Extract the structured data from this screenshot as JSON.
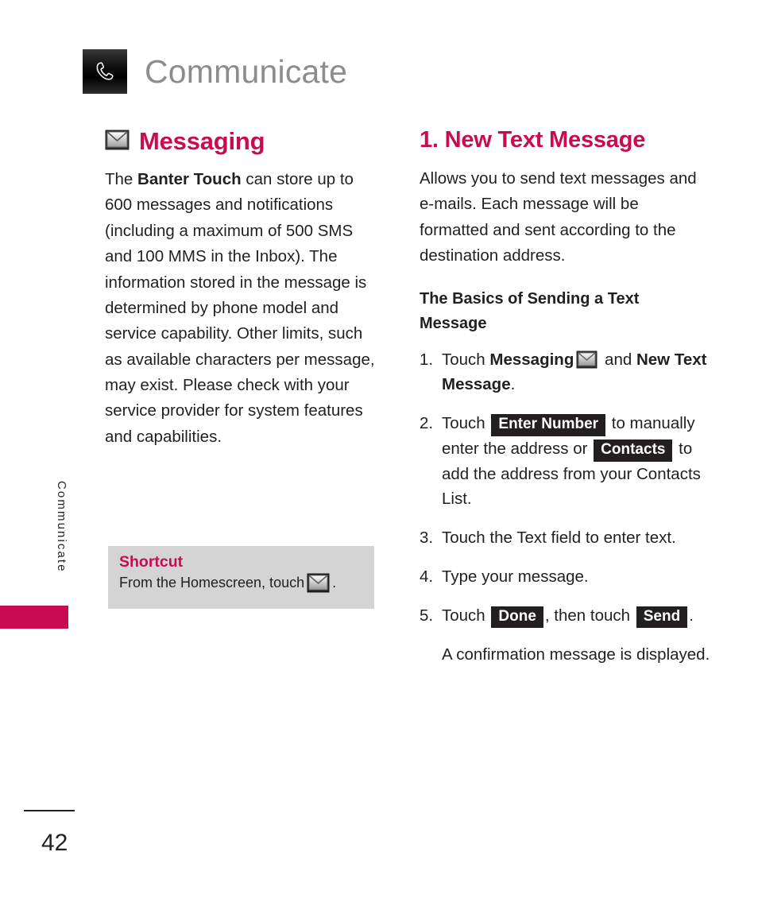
{
  "page": {
    "header_title": "Communicate",
    "header_icon": "phone-handset-icon",
    "side_tab_label": "Communicate",
    "page_number": "42",
    "accent_color": "#C80C52",
    "header_title_color": "#8C8C8C",
    "callout_bg_color": "#D4D4D4",
    "key_chip_color": "#231F20"
  },
  "left_column": {
    "heading": "Messaging",
    "heading_icon": "envelope-icon",
    "paragraph_parts": {
      "before_bold": "The ",
      "bold": "Banter Touch",
      "after_bold": " can store up to 600 messages and notifications (including a maximum of 500 SMS and 100 MMS in the Inbox). The information stored in the message is determined by phone model and service capability. Other limits, such as available characters per message, may exist. Please check with your service provider for system features and capabilities."
    },
    "shortcut": {
      "title": "Shortcut",
      "text_before_icon": "From the Homescreen, touch ",
      "icon": "envelope-icon",
      "text_after_icon": "."
    }
  },
  "right_column": {
    "heading": "1. New Text Message",
    "intro": "Allows you to send text messages and e-mails. Each message will be formatted and sent according to the destination address.",
    "subheading": "The Basics of Sending a Text Message",
    "steps": [
      {
        "number": "1.",
        "part1": "Touch ",
        "bold1": "Messaging",
        "icon": "envelope-icon",
        "part2": " and ",
        "bold2": "New Text Message",
        "part3": "."
      },
      {
        "number": "2.",
        "part1": "Touch ",
        "key1": "Enter Number",
        "part2": " to manually enter the address or ",
        "key2": "Contacts",
        "part3": " to add the address from your Contacts List."
      },
      {
        "number": "3.",
        "part1": "Touch the Text field to enter text."
      },
      {
        "number": "4.",
        "part1": "Type your message."
      },
      {
        "number": "5.",
        "part1": "Touch ",
        "key1": "Done",
        "part2": ", then touch ",
        "key2": "Send",
        "part3": "."
      }
    ],
    "note": "A confirmation message is displayed."
  }
}
